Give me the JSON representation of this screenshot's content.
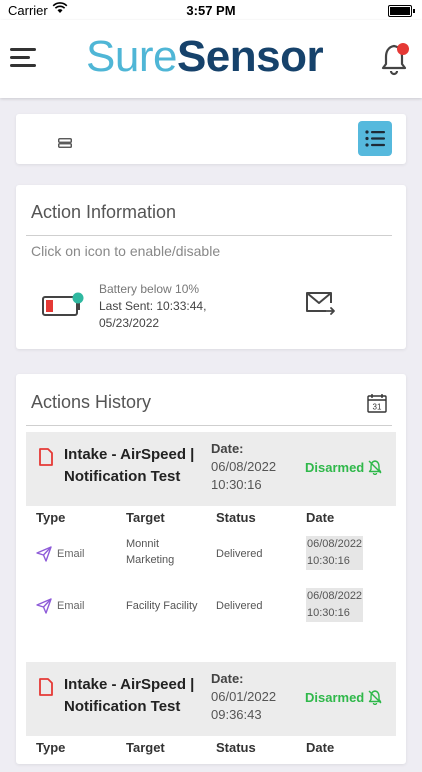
{
  "status_bar": {
    "carrier": "Carrier",
    "time": "3:57 PM"
  },
  "header": {
    "logo_part1": "Sure",
    "logo_part2": "Sensor",
    "notification_dot_color": "#e53935"
  },
  "colors": {
    "accent": "#56b9dd",
    "armed_status": "#2fb84a",
    "danger": "#e53935",
    "purple_icon": "#8e5bd8"
  },
  "action_info": {
    "title": "Action Information",
    "hint": "Click on icon to enable/disable",
    "battery_alert": "Battery below 10%",
    "last_sent_line1": "Last Sent: 10:33:44,",
    "last_sent_line2": "05/23/2022"
  },
  "history": {
    "title": "Actions History",
    "columns": [
      "Type",
      "Target",
      "Status",
      "Date"
    ],
    "items": [
      {
        "title_line1": "Intake - AirSpeed |",
        "title_line2": "Notification Test",
        "date_label": "Date:",
        "date": "06/08/2022",
        "time": "10:30:16",
        "status": "Disarmed",
        "rows": [
          {
            "type": "Email",
            "target_line1": "Monnit",
            "target_line2": "Marketing",
            "status": "Delivered",
            "date_line1": "06/08/2022",
            "date_line2": "10:30:16"
          },
          {
            "type": "Email",
            "target_line1": "Facility Facility",
            "target_line2": "",
            "status": "Delivered",
            "date_line1": "06/08/2022",
            "date_line2": "10:30:16"
          }
        ]
      },
      {
        "title_line1": "Intake - AirSpeed |",
        "title_line2": "Notification Test",
        "date_label": "Date:",
        "date": "06/01/2022",
        "time": "09:36:43",
        "status": "Disarmed",
        "rows": []
      }
    ]
  }
}
